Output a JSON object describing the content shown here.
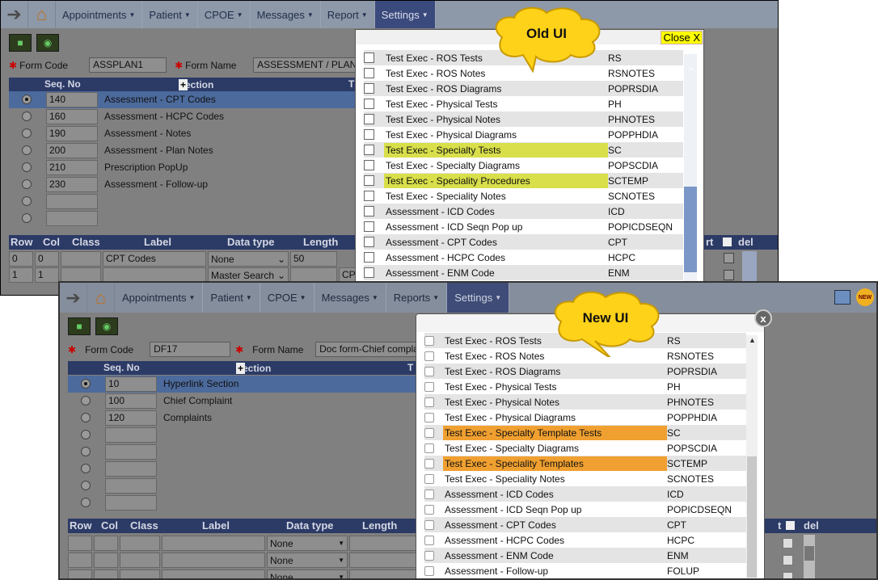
{
  "old_ui": {
    "nav": [
      "Appointments",
      "Patient",
      "CPOE",
      "Messages",
      "Report",
      "Settings"
    ],
    "form": {
      "code_label": "Form Code",
      "code_value": "ASSPLAN1",
      "name_label": "Form Name",
      "name_value": "ASSESSMENT / PLAN"
    },
    "sections_header": {
      "seq": "Seq. No",
      "section": "Section",
      "trailing": "T"
    },
    "sections": [
      {
        "seq": "140",
        "name": "Assessment - CPT Codes"
      },
      {
        "seq": "160",
        "name": "Assessment - HCPC Codes"
      },
      {
        "seq": "190",
        "name": "Assessment - Notes"
      },
      {
        "seq": "200",
        "name": "Assessment - Plan Notes"
      },
      {
        "seq": "210",
        "name": "Prescription PopUp"
      },
      {
        "seq": "230",
        "name": "Assessment - Follow-up"
      },
      {
        "seq": "",
        "name": ""
      },
      {
        "seq": "",
        "name": ""
      }
    ],
    "bottom_header": {
      "row": "Row",
      "col": "Col",
      "class": "Class",
      "label": "Label",
      "dtype": "Data type",
      "length": "Length",
      "rt": "rt",
      "del": "del"
    },
    "bottom_rows": [
      {
        "row": "0",
        "col": "0",
        "label": "CPT Codes",
        "dtype": "None",
        "length": "50"
      },
      {
        "row": "1",
        "col": "1",
        "label": "",
        "dtype": "Master Search",
        "length": "CP"
      }
    ],
    "callout": "Old UI",
    "close_label": "Close X",
    "popup_rows": [
      {
        "label": "Test Exec - ROS Tests",
        "code": "RS"
      },
      {
        "label": "Test Exec - ROS Notes",
        "code": "RSNOTES"
      },
      {
        "label": "Test Exec - ROS Diagrams",
        "code": "POPRSDIA"
      },
      {
        "label": "Test Exec - Physical Tests",
        "code": "PH"
      },
      {
        "label": "Test Exec - Physical Notes",
        "code": "PHNOTES"
      },
      {
        "label": "Test Exec - Physical Diagrams",
        "code": "POPPHDIA"
      },
      {
        "label": "Test Exec - Specialty Tests",
        "code": "SC"
      },
      {
        "label": "Test Exec - Specialty Diagrams",
        "code": "POPSCDIA"
      },
      {
        "label": "Test Exec - Speciality Procedures",
        "code": "SCTEMP"
      },
      {
        "label": "Test Exec - Speciality Notes",
        "code": "SCNOTES"
      },
      {
        "label": "Assessment - ICD Codes",
        "code": "ICD"
      },
      {
        "label": "Assessment - ICD Seqn Pop up",
        "code": "POPICDSEQN"
      },
      {
        "label": "Assessment - CPT Codes",
        "code": "CPT"
      },
      {
        "label": "Assessment - HCPC Codes",
        "code": "HCPC"
      },
      {
        "label": "Assessment - ENM Code",
        "code": "ENM"
      }
    ]
  },
  "new_ui": {
    "nav": [
      "Appointments",
      "Patient",
      "CPOE",
      "Messages",
      "Reports",
      "Settings"
    ],
    "form": {
      "code_label": "Form Code",
      "code_value": "DF17",
      "name_label": "Form Name",
      "name_value": "Doc form-Chief complain"
    },
    "sections_header": {
      "seq": "Seq. No",
      "section": "Section",
      "trailing": "T"
    },
    "sections": [
      {
        "seq": "10",
        "name": "Hyperlink Section"
      },
      {
        "seq": "100",
        "name": "Chief Complaint"
      },
      {
        "seq": "120",
        "name": "Complaints"
      },
      {
        "seq": "",
        "name": ""
      },
      {
        "seq": "",
        "name": ""
      },
      {
        "seq": "",
        "name": ""
      },
      {
        "seq": "",
        "name": ""
      },
      {
        "seq": "",
        "name": ""
      }
    ],
    "bottom_header": {
      "row": "Row",
      "col": "Col",
      "class": "Class",
      "label": "Label",
      "dtype": "Data type",
      "length": "Length",
      "rt": "t",
      "del": "del"
    },
    "bottom_rows": [
      {
        "dtype": "None"
      },
      {
        "dtype": "None"
      },
      {
        "dtype": "None"
      }
    ],
    "callout": "New UI",
    "close_label": "x",
    "badge": "NEW",
    "popup_rows": [
      {
        "label": "Test Exec - ROS Tests",
        "code": "RS"
      },
      {
        "label": "Test Exec - ROS Notes",
        "code": "RSNOTES"
      },
      {
        "label": "Test Exec - ROS Diagrams",
        "code": "POPRSDIA"
      },
      {
        "label": "Test Exec - Physical Tests",
        "code": "PH"
      },
      {
        "label": "Test Exec - Physical Notes",
        "code": "PHNOTES"
      },
      {
        "label": "Test Exec - Physical Diagrams",
        "code": "POPPHDIA"
      },
      {
        "label": "Test Exec - Specialty Template Tests",
        "code": "SC"
      },
      {
        "label": "Test Exec - Specialty Diagrams",
        "code": "POPSCDIA"
      },
      {
        "label": "Test Exec - Speciality Templates",
        "code": "SCTEMP"
      },
      {
        "label": "Test Exec - Speciality Notes",
        "code": "SCNOTES"
      },
      {
        "label": "Assessment - ICD Codes",
        "code": "ICD"
      },
      {
        "label": "Assessment - ICD Seqn Pop up",
        "code": "POPICDSEQN"
      },
      {
        "label": "Assessment - CPT Codes",
        "code": "CPT"
      },
      {
        "label": "Assessment - HCPC Codes",
        "code": "HCPC"
      },
      {
        "label": "Assessment - ENM Code",
        "code": "ENM"
      },
      {
        "label": "Assessment - Follow-up",
        "code": "FOLUP"
      }
    ]
  },
  "colors": {
    "yellow_highlight": "#d8df4a",
    "orange_highlight": "#f0a030",
    "nav_active": "#3b4a7c",
    "callout": "#ffd21a"
  }
}
